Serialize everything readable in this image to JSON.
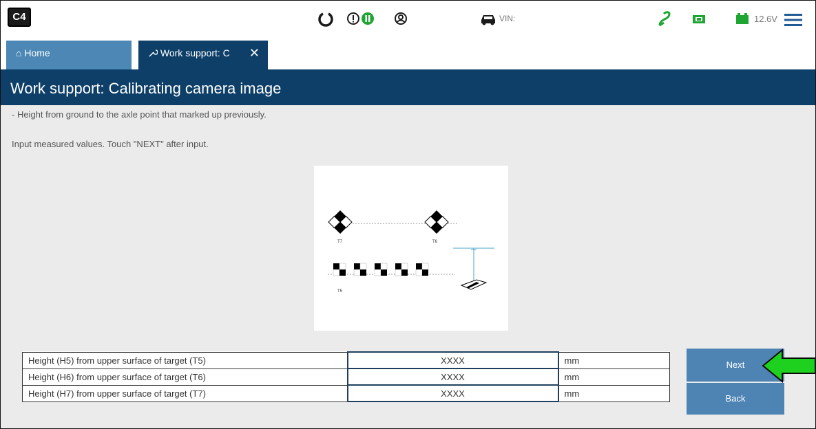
{
  "app": {
    "logo_text": "C4"
  },
  "topbar": {
    "icons": [
      "refresh-icon",
      "alert-icon",
      "pause-icon",
      "user-icon",
      "car-icon",
      "signal-icon",
      "vci-icon",
      "battery-icon",
      "menu-icon"
    ],
    "vin_label": "VIN:",
    "voltage": "12.6V",
    "colors": {
      "green": "#1ea532",
      "dark": "#1a1a1a",
      "blue": "#1f5b95"
    }
  },
  "tabs": [
    {
      "label": "Home",
      "icon": "home-icon"
    },
    {
      "label": "Work support: C",
      "icon": "wrench-icon",
      "close": "✕"
    }
  ],
  "header": {
    "title": "Work support: Calibrating camera image"
  },
  "instructions": {
    "line1": "- Height from ground to the axle point that marked up previously.",
    "line2": "Input measured values. Touch \"NEXT\" after input."
  },
  "diagram": {
    "labels": [
      "T7",
      "T6",
      "T5"
    ]
  },
  "measurements": [
    {
      "label": "Height (H5) from upper surface of target (T5)",
      "value": "XXXX",
      "unit": "mm"
    },
    {
      "label": "Height (H6) from upper surface of target (T6)",
      "value": "XXXX",
      "unit": "mm"
    },
    {
      "label": "Height (H7) from upper surface of target (T7)",
      "value": "XXXX",
      "unit": "mm"
    }
  ],
  "buttons": {
    "next": "Next",
    "back": "Back"
  },
  "accent": {
    "arrow": "#1fd11f",
    "header": "#0d3f69",
    "button": "#4d84b3"
  }
}
